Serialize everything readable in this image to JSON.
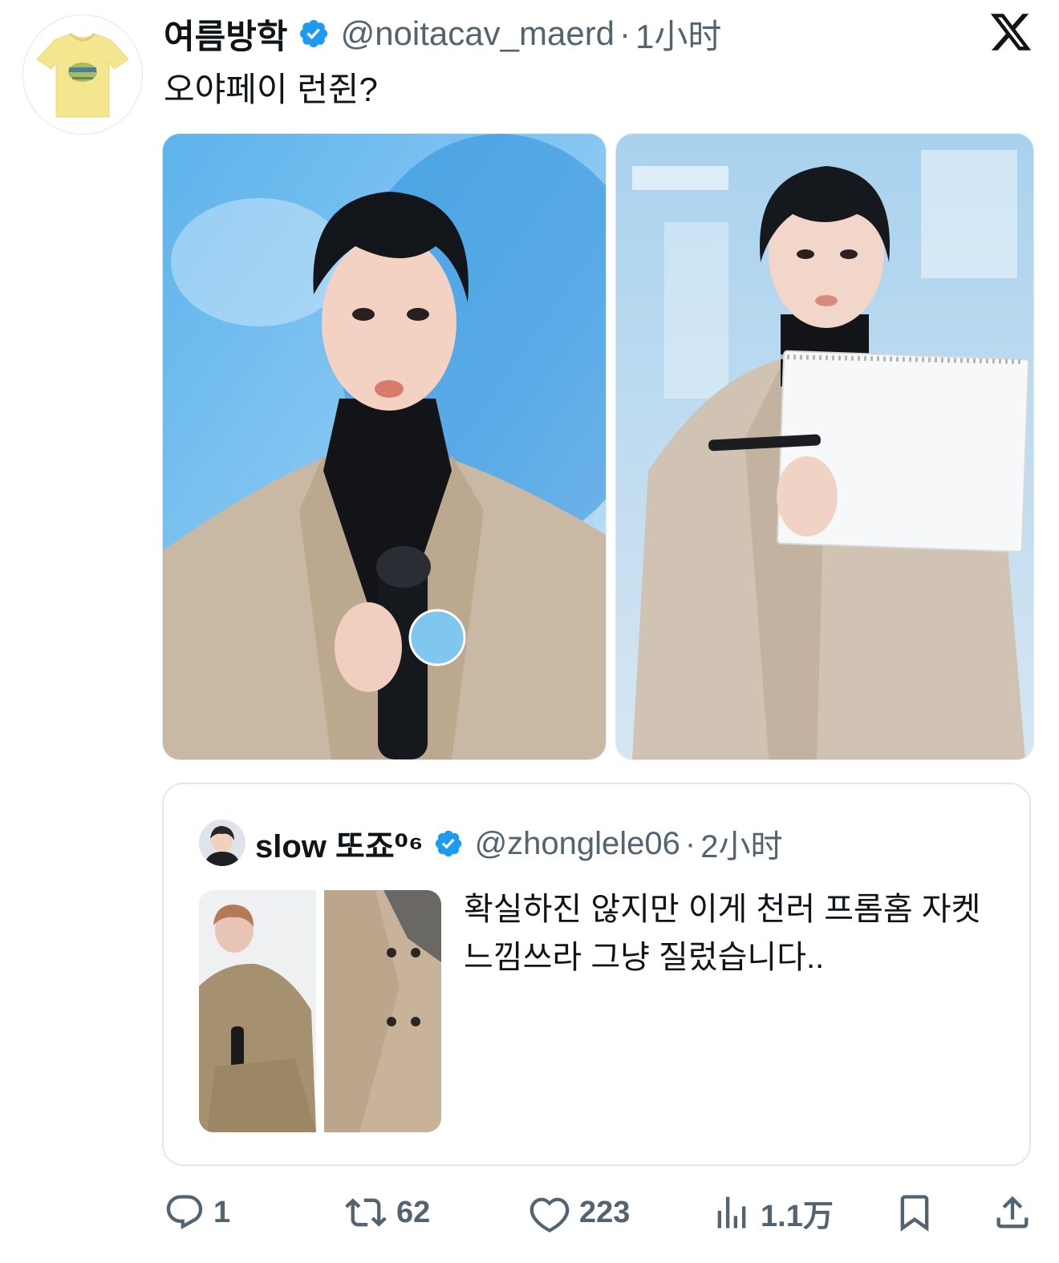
{
  "post": {
    "display_name": "여름방학",
    "handle": "@noitacav_maerd",
    "separator": "·",
    "time": "1小时",
    "text": "오야페이 런쥔?"
  },
  "quoted": {
    "display_name": "slow 또죠⁰⁶",
    "handle": "@zhonglele06",
    "separator": "·",
    "time": "2小时",
    "text": "확실하진 않지만 이게 천러 프롬홈 자켓 느낌쓰라 그냥 질렀습니다.."
  },
  "actions": {
    "replies": "1",
    "reposts": "62",
    "likes": "223",
    "views": "1.1万"
  },
  "colors": {
    "text": "#0f1419",
    "secondary": "#536471",
    "verified": "#1d9bf0",
    "border": "#e1e8ed"
  },
  "icons": [
    "x-logo-icon",
    "verified-badge-icon",
    "reply-icon",
    "repost-icon",
    "like-icon",
    "views-icon",
    "bookmark-icon",
    "share-icon"
  ]
}
